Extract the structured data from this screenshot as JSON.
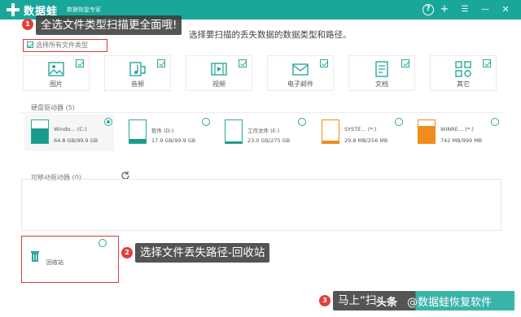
{
  "app": {
    "name": "数据蛙",
    "subtitle": "数据恢复专家"
  },
  "window": {
    "help": "?",
    "add": "+",
    "minimize": "—",
    "close": "✕"
  },
  "instruction": "选择要扫描的丢失数据的数据类型和路径。",
  "select_all": {
    "label": "选择所有文件类型",
    "checked": true
  },
  "file_types": [
    {
      "label": "图片",
      "icon": "image-icon",
      "checked": true
    },
    {
      "label": "音频",
      "icon": "audio-icon",
      "checked": true
    },
    {
      "label": "视频",
      "icon": "video-icon",
      "checked": true
    },
    {
      "label": "电子邮件",
      "icon": "email-icon",
      "checked": true
    },
    {
      "label": "文档",
      "icon": "document-icon",
      "checked": true
    },
    {
      "label": "其它",
      "icon": "other-icon",
      "checked": true
    }
  ],
  "disks_section": {
    "title": "硬盘驱动器 (5)"
  },
  "disks": [
    {
      "name": "Windo… (C:)",
      "size": "64.8 GB/99.9 GB",
      "fill": 0.65,
      "color": "#1a9a8c",
      "selected": true
    },
    {
      "name": "软件 (D:)",
      "size": "17.9 GB/99.9 GB",
      "fill": 0.18,
      "color": "#1a9a8c",
      "selected": false
    },
    {
      "name": "工作文件 (E:)",
      "size": "23.0 GB/275 GB",
      "fill": 0.08,
      "color": "#1a9a8c",
      "selected": false
    },
    {
      "name": "SYSTE… (*:)",
      "size": "29.8 MB/256 MB",
      "fill": 0.12,
      "color": "#f08c1a",
      "selected": false
    },
    {
      "name": "WINRE… (*:)",
      "size": "742 MB/999 MB",
      "fill": 0.74,
      "color": "#f08c1a",
      "selected": false
    }
  ],
  "removable_section": {
    "title": "可移动驱动器 (0)"
  },
  "recycle": {
    "label": "回收站"
  },
  "tips": {
    "tip1": {
      "number": "1",
      "text": "全选文件类型扫描更全面哦!"
    },
    "tip2": {
      "number": "2",
      "text": "选择文件丢失路径-回收站"
    },
    "tip3": {
      "number": "3",
      "text": "马上“扫"
    }
  },
  "watermark": {
    "left": "头条",
    "right": "@数据蛙恢复软件"
  },
  "colors": {
    "accent": "#18a79a",
    "highlight": "#d53a3a",
    "orange": "#f08c1a"
  }
}
